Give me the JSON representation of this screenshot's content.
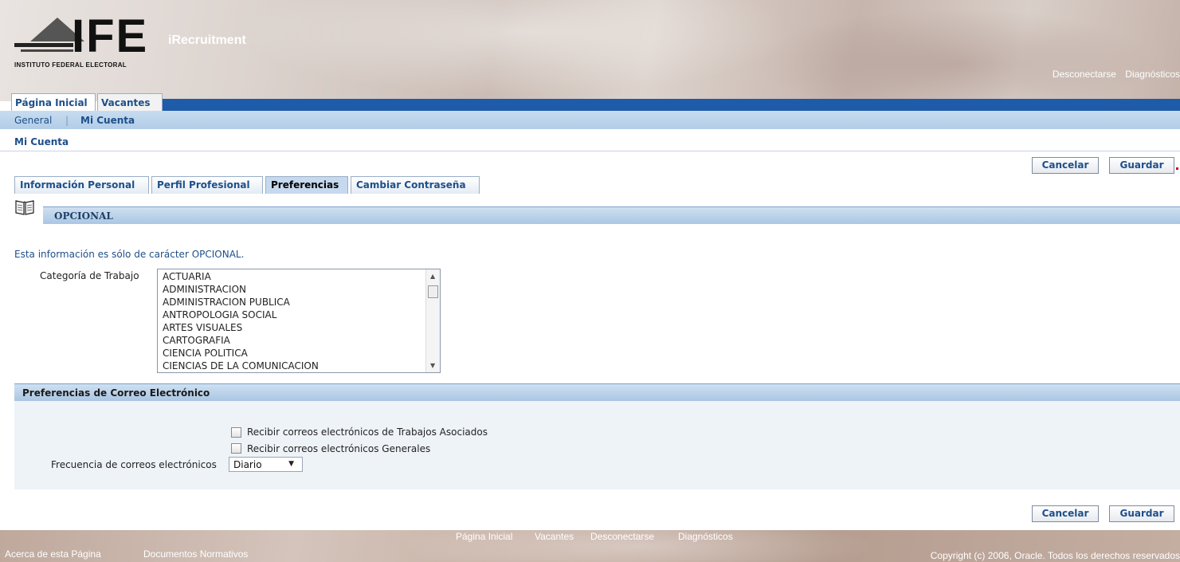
{
  "header": {
    "logo_text": "IFE",
    "institution": "INSTITUTO FEDERAL ELECTORAL",
    "app_name": "iRecruitment",
    "global_links": [
      "Desconectarse",
      "Diagnósticos"
    ]
  },
  "tabs": [
    {
      "label": "Página Inicial"
    },
    {
      "label": "Vacantes"
    }
  ],
  "subnav": {
    "items": [
      "General",
      "Mi Cuenta"
    ],
    "separator": "|"
  },
  "breadcrumb": "Mi Cuenta",
  "buttons": {
    "cancel": "Cancelar",
    "save": "Guardar"
  },
  "subtabs": [
    {
      "label": "Información Personal"
    },
    {
      "label": "Perfil Profesional"
    },
    {
      "label": "Preferencias",
      "selected": true
    },
    {
      "label": "Cambiar Contraseña"
    }
  ],
  "optional_section": {
    "title": "OPCIONAL",
    "info": "Esta información es sólo de carácter OPCIONAL.",
    "category_label": "Categoría de Trabajo",
    "categories": [
      "ACTUARIA",
      "ADMINISTRACION",
      "ADMINISTRACION PUBLICA",
      "ANTROPOLOGIA SOCIAL",
      "ARTES VISUALES",
      "CARTOGRAFIA",
      "CIENCIA POLITICA",
      "CIENCIAS DE LA COMUNICACION"
    ]
  },
  "email_section": {
    "title": "Preferencias de Correo Electrónico",
    "checkbox1": "Recibir correos electrónicos de Trabajos Asociados",
    "checkbox2": "Recibir correos electrónicos Generales",
    "frequency_label": "Frecuencia de correos electrónicos",
    "frequency_value": "Diario"
  },
  "footer": {
    "links": [
      "Página Inicial",
      "Vacantes",
      "Desconectarse",
      "Diagnósticos"
    ],
    "bottom_links": [
      "Acerca de esta Página",
      "Documentos Normativos"
    ],
    "copyright": "Copyright (c) 2006, Oracle. Todos los derechos reservados"
  },
  "colors": {
    "link_blue": "#1e4f8a",
    "tab_bar_blue": "#1e5ba8",
    "section_header": "#b8d0e8"
  }
}
